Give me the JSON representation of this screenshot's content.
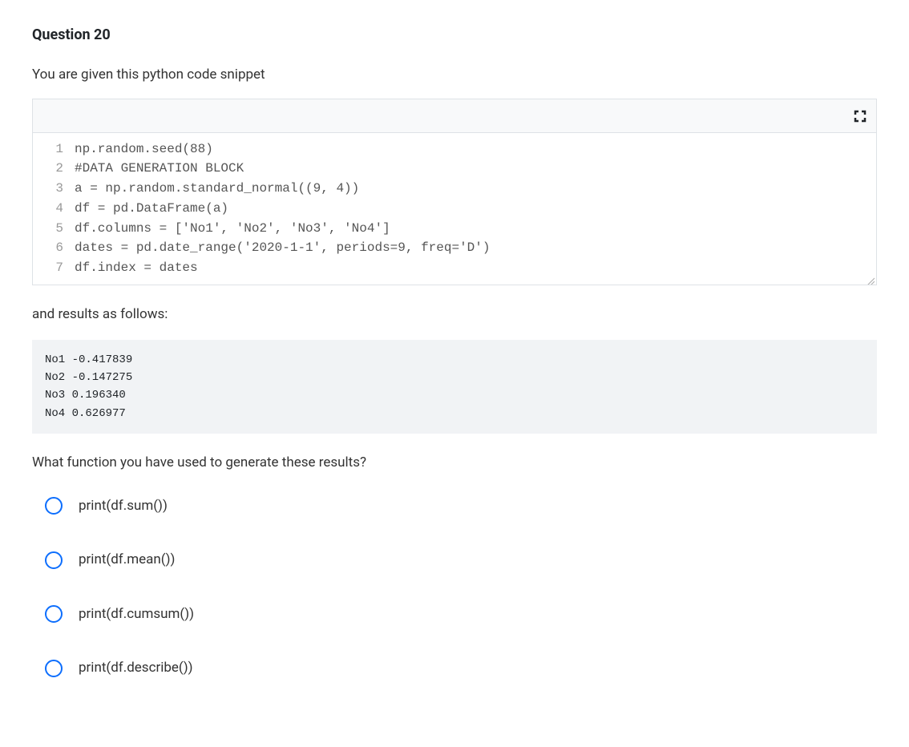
{
  "question": {
    "title": "Question 20",
    "intro": "You are given this python code snippet",
    "code": {
      "lines": [
        {
          "num": "1",
          "text": "np.random.seed(88)"
        },
        {
          "num": "2",
          "text": "#DATA GENERATION BLOCK"
        },
        {
          "num": "3",
          "text": "a = np.random.standard_normal((9, 4))"
        },
        {
          "num": "4",
          "text": "df = pd.DataFrame(a)"
        },
        {
          "num": "5",
          "text": "df.columns = ['No1', 'No2', 'No3', 'No4']"
        },
        {
          "num": "6",
          "text": "dates = pd.date_range('2020-1-1', periods=9, freq='D')"
        },
        {
          "num": "7",
          "text": "df.index = dates"
        }
      ]
    },
    "results_intro": "and results as follows:",
    "results": "No1 -0.417839\nNo2 -0.147275\nNo3 0.196340\nNo4 0.626977",
    "prompt": "What function you have used to generate these results?",
    "options": [
      {
        "label": "print(df.sum())"
      },
      {
        "label": "print(df.mean())"
      },
      {
        "label": "print(df.cumsum())"
      },
      {
        "label": "print(df.describe())"
      }
    ]
  }
}
